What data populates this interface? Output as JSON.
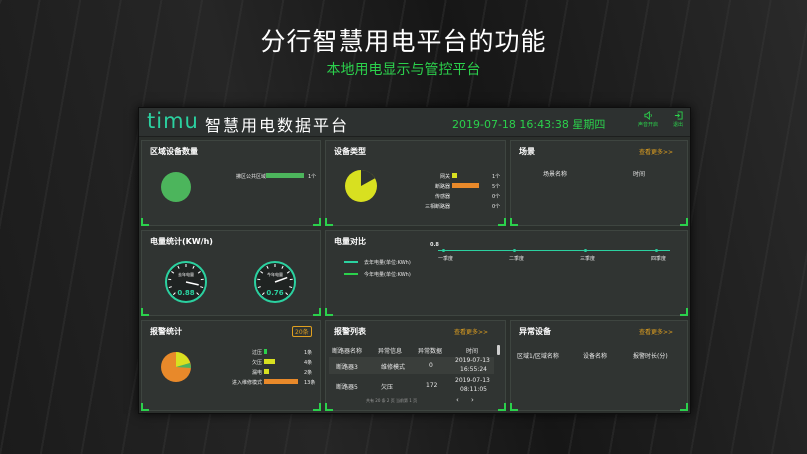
{
  "slide": {
    "title": "分行智慧用电平台的功能",
    "subtitle": "本地用电显示与管控平台"
  },
  "app": {
    "logo": "timu",
    "title": "智慧用电数据平台",
    "datetime": "2019-07-18 16:43:38 星期四",
    "buttons": [
      {
        "label": "声音开启",
        "icon": "speaker-icon"
      },
      {
        "label": "退出",
        "icon": "exit-icon"
      }
    ]
  },
  "colors": {
    "accent": "#2bd14c",
    "orange": "#e8892a",
    "yellow": "#d8e020",
    "teal": "#2bd1a0"
  },
  "region_devices": {
    "title": "区域设备数量",
    "items": [
      {
        "label": "拂区公共区域",
        "count": "1个",
        "fraction": 1.0
      }
    ]
  },
  "device_types": {
    "title": "设备类型",
    "items": [
      {
        "label": "网关",
        "count": "1个",
        "fraction": 0.17,
        "color": "#d8e020"
      },
      {
        "label": "断路器",
        "count": "5个",
        "fraction": 0.83,
        "color": "#e8892a"
      },
      {
        "label": "传感器",
        "count": "0个",
        "fraction": 0,
        "color": "#2bd14c"
      },
      {
        "label": "三相断路器",
        "count": "0个",
        "fraction": 0,
        "color": "#2bd14c"
      }
    ]
  },
  "scene": {
    "title": "场景",
    "more": "查看更多>>",
    "columns": [
      "场景名称",
      "时间"
    ]
  },
  "power_stats": {
    "title": "电量统计(KW/h)",
    "gauges": [
      {
        "caption": "去年电量",
        "value": "0.88"
      },
      {
        "caption": "今年电量",
        "value": "0.76"
      }
    ]
  },
  "power_compare": {
    "title": "电量对比",
    "legend": [
      "去年电量(单位:KWh)",
      "今年电量(单位:KWh)"
    ],
    "y_tick": "0.8",
    "categories": [
      "一季度",
      "二季度",
      "三季度",
      "四季度"
    ]
  },
  "alarm_stats": {
    "title": "报警统计",
    "badge": "20条",
    "items": [
      {
        "label": "过压",
        "count": "1条",
        "fraction": 0.08,
        "color": "#2bd14c"
      },
      {
        "label": "欠压",
        "count": "4条",
        "fraction": 0.31,
        "color": "#d8e020"
      },
      {
        "label": "漏电",
        "count": "2条",
        "fraction": 0.15,
        "color": "#d8e020"
      },
      {
        "label": "进入维修模式",
        "count": "13条",
        "fraction": 1.0,
        "color": "#e8892a"
      }
    ]
  },
  "alarm_list": {
    "title": "报警列表",
    "more": "查看更多>>",
    "columns": [
      "断路器名称",
      "异常信息",
      "异常数据",
      "时间"
    ],
    "rows": [
      {
        "name": "断路器3",
        "info": "维修模式",
        "data": "0",
        "time1": "2019-07-13",
        "time2": "16:55:24"
      },
      {
        "name": "断路器5",
        "info": "欠压",
        "data": "172",
        "time1": "2019-07-13",
        "time2": "08:11:05"
      }
    ],
    "pager": "共有 20 条 2 页 当前第 1 页"
  },
  "abnormal_devices": {
    "title": "异常设备",
    "more": "查看更多>>",
    "columns": [
      "区域1/区域名称",
      "设备名称",
      "报警时长(分)"
    ]
  }
}
